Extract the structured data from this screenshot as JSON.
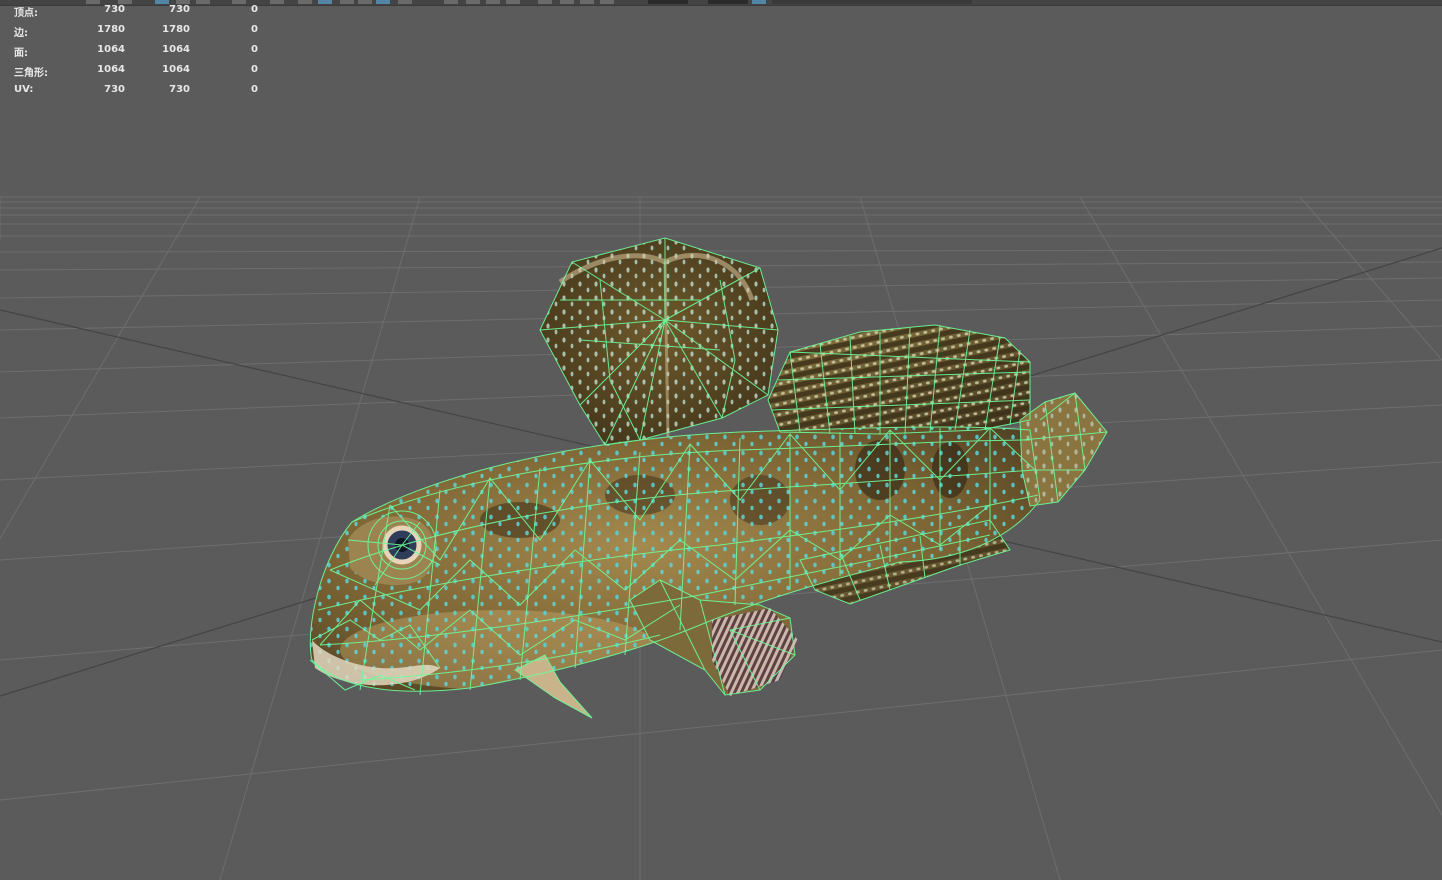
{
  "hud": {
    "rows": [
      {
        "label": "顶点:",
        "selected": "730",
        "total": "730",
        "extra": "0"
      },
      {
        "label": "边:",
        "selected": "1780",
        "total": "1780",
        "extra": "0"
      },
      {
        "label": "面:",
        "selected": "1064",
        "total": "1064",
        "extra": "0"
      },
      {
        "label": "三角形:",
        "selected": "1064",
        "total": "1064",
        "extra": "0"
      },
      {
        "label": "UV:",
        "selected": "730",
        "total": "730",
        "extra": "0"
      }
    ]
  },
  "colors": {
    "viewport_bg": "#5b5b5b",
    "grid": "#6e6e6e",
    "wireframe": "#6dfc9c",
    "toolbar_active": "#5285a6"
  },
  "model": {
    "name_icon": "fish-mesh-icon"
  }
}
